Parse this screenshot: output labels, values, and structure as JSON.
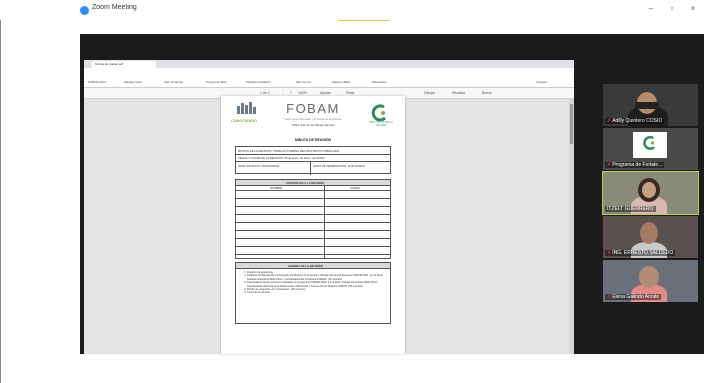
{
  "window": {
    "title": "Zoom Meeting",
    "controls": [
      "–",
      "▫",
      "×"
    ]
  },
  "browser": {
    "tab_title": "Minuta de trabajo.pdf",
    "url": "C:/Users/Archivo/FOBAM/Desktop/Minuta/MINUTA.pdf",
    "bookmarks": [
      "FOBAM 2021",
      "Manejo redes",
      "Fed. Finanzas",
      "Programa SEQ",
      "Plataforma IDECA",
      "Mis Cursos",
      "Sistema IEEA",
      "Planeación",
      "Carpeta"
    ],
    "pdf_toolbar": [
      "1 de 2",
      "–",
      "+",
      "100%",
      "Ajustar",
      "Rotar",
      "Dibujar",
      "Resaltar",
      "Borrar"
    ]
  },
  "document": {
    "left_logo_text": "CONOCIENDO",
    "title": "FOBAM",
    "subtitle": "Fondo para el Bienestar y el Avance de las Mujeres",
    "year_line": "“2021: Año de la Independencia”",
    "right_logo_text": "INSTITUTO DE LA MUJER",
    "minuta_title": "MINUTA DE REUNIÓN",
    "fields": {
      "subject": "MOTIVO DE LA REUNIÓN: TRABAJO INTERNO DEL PROYECTO FOBAM 2021",
      "date_place": "FECHA Y LUGAR DE LA REUNIÓN: 18 de enero de 2021, vía ZOOM",
      "start_time": "HORA DE INICIO: 10:00 HORAS",
      "end_time": "HORA DE TERMINACIÓN: 11:00 HORAS"
    },
    "attendance": {
      "header": "ASISTENTES A LA REUNIÓN",
      "col_name": "NOMBRE",
      "col_position": "CARGO"
    },
    "agenda": {
      "header": "AGENDA DE LA REUNIÓN",
      "items": [
        "Registro de asistencia.",
        "Palabras de Bienvenida y Exposición de Motivos de la reunión Trabajo Interno del Proyecto FOBAM 2021, por la Mtra. Arabella Stephanie Bello Pérez, Coordinadora del Programa FOBAM. (10 minutos)",
        "Presentación de las acciones realizadas en el ejercicio FOBAM 2020, por la Mtra. Daniela Dominique Bello Pérez, Coordinadora del Programa Fobam para el Bienestar y Avance de las Mujeres FOBAM. (30 minutos)",
        "Ronda de preguntas y/o comentarios. (15 minutos)",
        "Cierre de la reunión."
      ]
    }
  },
  "participants": [
    {
      "name": "Adilly Quintero COSIO",
      "muted": true
    },
    {
      "name": "Programa de Fortale...",
      "muted": true
    },
    {
      "name": "ITZELT GUERRERO",
      "muted": false
    },
    {
      "name": "ING. ERNESTO SALCEDO",
      "muted": true
    },
    {
      "name": "Elena Galindo Arzate",
      "muted": true
    }
  ],
  "colors": {
    "meeting_bg": "#1b1b1b",
    "active_speaker": "#b5d334",
    "zoom_blue": "#2d8cff"
  }
}
